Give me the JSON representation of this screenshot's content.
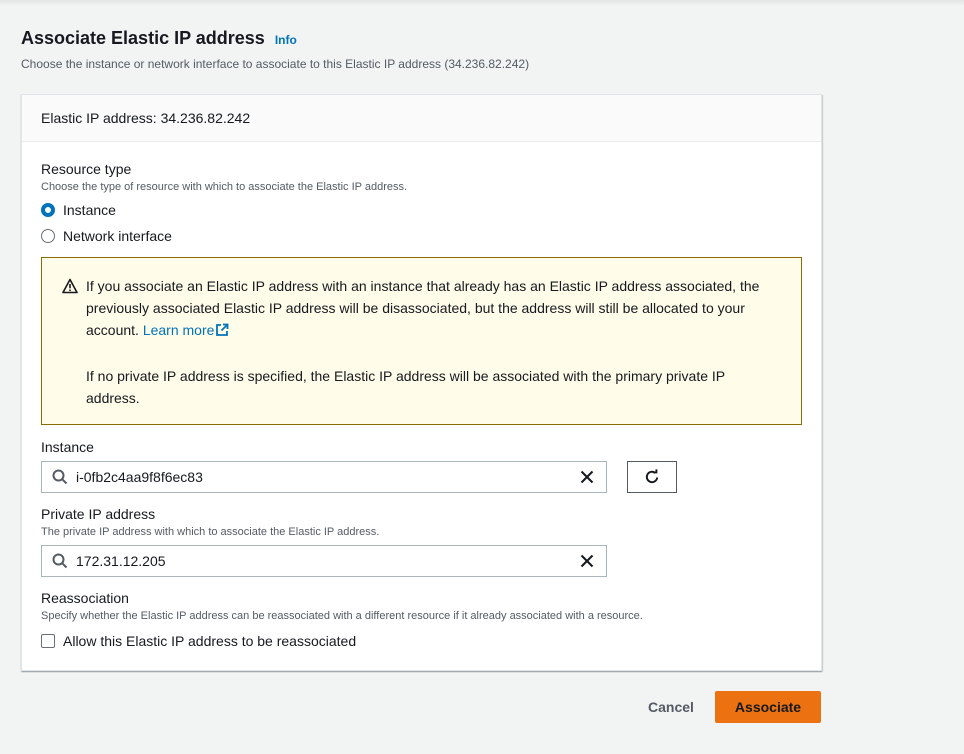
{
  "page": {
    "title": "Associate Elastic IP address",
    "info_label": "Info",
    "description": "Choose the instance or network interface to associate to this Elastic IP address (34.236.82.242)"
  },
  "panel": {
    "header": "Elastic IP address: 34.236.82.242"
  },
  "resource_type": {
    "label": "Resource type",
    "description": "Choose the type of resource with which to associate the Elastic IP address.",
    "options": [
      {
        "label": "Instance",
        "selected": true
      },
      {
        "label": "Network interface",
        "selected": false
      }
    ]
  },
  "alert": {
    "text_1": "If you associate an Elastic IP address with an instance that already has an Elastic IP address associated, the previously associated Elastic IP address will be disassociated, but the address will still be allocated to your account.",
    "link": "Learn more",
    "text_2": "If no private IP address is specified, the Elastic IP address will be associated with the primary private IP address.",
    "border_color": "#8a6d05",
    "background": "#fffce9"
  },
  "instance": {
    "label": "Instance",
    "value": "i-0fb2c4aa9f8f6ec83"
  },
  "private_ip": {
    "label": "Private IP address",
    "description": "The private IP address with which to associate the Elastic IP address.",
    "value": "172.31.12.205"
  },
  "reassociation": {
    "label": "Reassociation",
    "description": "Specify whether the Elastic IP address can be reassociated with a different resource if it already associated with a resource.",
    "checkbox_label": "Allow this Elastic IP address to be reassociated",
    "checked": false
  },
  "actions": {
    "cancel": "Cancel",
    "associate": "Associate"
  },
  "colors": {
    "accent": "#0073bb",
    "primary_button": "#ec7211"
  },
  "icons": [
    "warning-icon",
    "external-link-icon",
    "search-icon",
    "clear-icon",
    "refresh-icon"
  ]
}
